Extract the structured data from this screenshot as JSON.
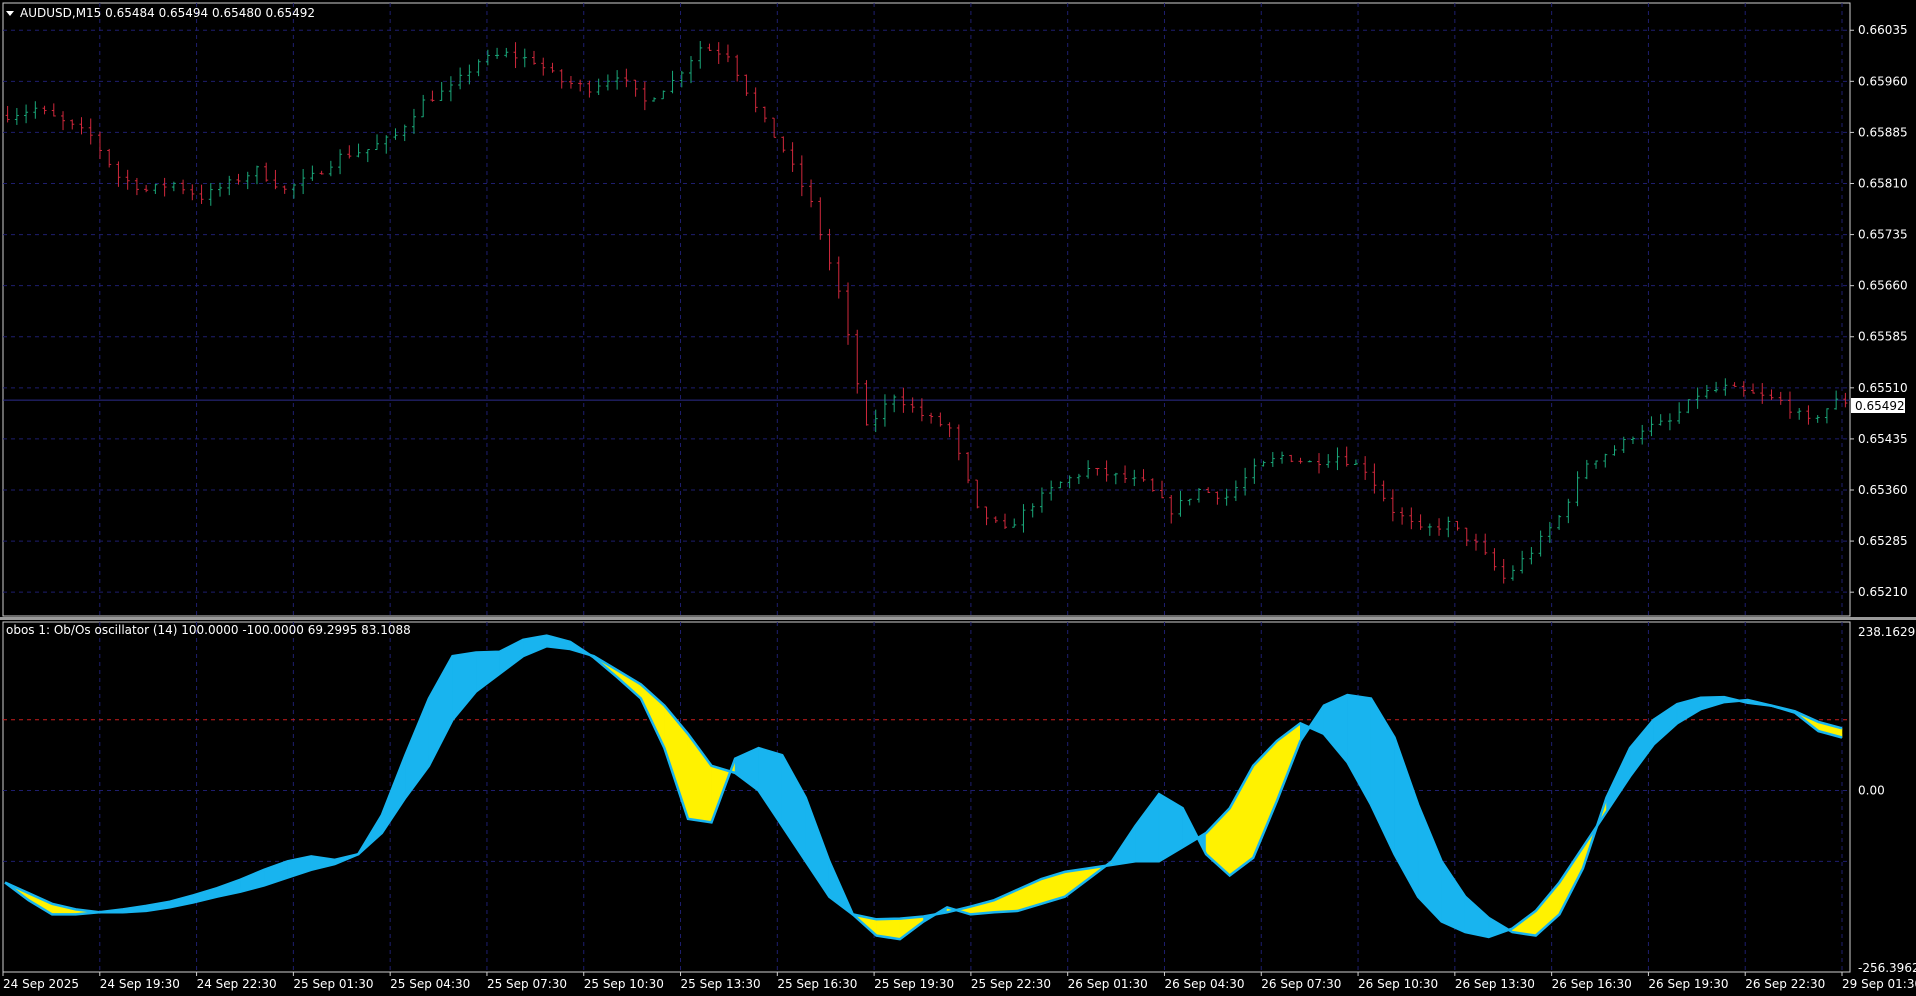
{
  "main_panel": {
    "title": "AUDUSD,M15  0.65484 0.65494 0.65480 0.65492",
    "collapse_icon": "triangle-down-icon",
    "current_price_label": "0.65492"
  },
  "oscillator_panel": {
    "title": "obos 1: Ob/Os oscillator (14) 100.0000 -100.0000 69.2995 83.1088",
    "level_colors": {
      "overbought": "#c81e1e",
      "zero": "#2a2a6e"
    }
  },
  "colors": {
    "background": "#000000",
    "grid": "#1e1e6e",
    "bull": "#1aa87a",
    "bear": "#d0283c",
    "fill_up": "#18b4ef",
    "fill_down": "#fff200",
    "text": "#ffffff",
    "price_line": "#2c2c8c"
  },
  "chart_data": [
    {
      "type": "candlestick",
      "symbol": "AUDUSD",
      "timeframe": "M15",
      "ylim": [
        0.65175,
        0.66075
      ],
      "y_ticks": [
        "0.66035",
        "0.65960",
        "0.65885",
        "0.65810",
        "0.65735",
        "0.65660",
        "0.65585",
        "0.65510",
        "0.65435",
        "0.65360",
        "0.65285",
        "0.65210"
      ],
      "current_price": 0.65492,
      "grid": true,
      "price_path": [
        [
          0,
          0.6591
        ],
        [
          3,
          0.6592
        ],
        [
          6,
          0.659
        ],
        [
          9,
          0.6588
        ],
        [
          12,
          0.6582
        ],
        [
          15,
          0.658
        ],
        [
          18,
          0.6581
        ],
        [
          21,
          0.6579
        ],
        [
          24,
          0.6581
        ],
        [
          27,
          0.6583
        ],
        [
          30,
          0.658
        ],
        [
          33,
          0.6582
        ],
        [
          36,
          0.6585
        ],
        [
          39,
          0.6586
        ],
        [
          42,
          0.6588
        ],
        [
          45,
          0.6593
        ],
        [
          48,
          0.6595
        ],
        [
          51,
          0.6599
        ],
        [
          54,
          0.66
        ],
        [
          57,
          0.6599
        ],
        [
          60,
          0.6596
        ],
        [
          63,
          0.6595
        ],
        [
          66,
          0.6597
        ],
        [
          69,
          0.6593
        ],
        [
          72,
          0.6596
        ],
        [
          75,
          0.6601
        ],
        [
          78,
          0.66
        ],
        [
          81,
          0.6592
        ],
        [
          84,
          0.6586
        ],
        [
          87,
          0.6578
        ],
        [
          90,
          0.6565
        ],
        [
          93,
          0.6545
        ],
        [
          96,
          0.655
        ],
        [
          99,
          0.6547
        ],
        [
          102,
          0.6545
        ],
        [
          105,
          0.6533
        ],
        [
          108,
          0.653
        ],
        [
          111,
          0.6534
        ],
        [
          114,
          0.6537
        ],
        [
          117,
          0.6539
        ],
        [
          120,
          0.6538
        ],
        [
          123,
          0.6537
        ],
        [
          126,
          0.6533
        ],
        [
          129,
          0.6536
        ],
        [
          132,
          0.6535
        ],
        [
          135,
          0.6539
        ],
        [
          138,
          0.6541
        ],
        [
          141,
          0.654
        ],
        [
          144,
          0.6541
        ],
        [
          147,
          0.6539
        ],
        [
          150,
          0.6533
        ],
        [
          153,
          0.653
        ],
        [
          156,
          0.6531
        ],
        [
          159,
          0.6528
        ],
        [
          162,
          0.6523
        ],
        [
          165,
          0.6527
        ],
        [
          168,
          0.6532
        ],
        [
          171,
          0.654
        ],
        [
          174,
          0.6542
        ],
        [
          177,
          0.6545
        ],
        [
          180,
          0.6546
        ],
        [
          183,
          0.655
        ],
        [
          186,
          0.6551
        ],
        [
          189,
          0.655
        ],
        [
          192,
          0.6549
        ],
        [
          195,
          0.6546
        ],
        [
          198,
          0.6549
        ],
        [
          200,
          0.6549
        ]
      ]
    },
    {
      "type": "area",
      "name": "Ob/Os oscillator (14)",
      "ylim": [
        -256.3962,
        238.1629
      ],
      "y_ticks": [
        "238.1629",
        "0.00",
        "-256.3962"
      ],
      "levels": [
        100,
        0,
        -100
      ],
      "x_labels": [
        "24 Sep 2025",
        "24 Sep 19:30",
        "24 Sep 22:30",
        "25 Sep 01:30",
        "25 Sep 04:30",
        "25 Sep 07:30",
        "25 Sep 10:30",
        "25 Sep 13:30",
        "25 Sep 16:30",
        "25 Sep 19:30",
        "25 Sep 22:30",
        "26 Sep 01:30",
        "26 Sep 04:30",
        "26 Sep 07:30",
        "26 Sep 10:30",
        "26 Sep 13:30",
        "26 Sep 16:30",
        "26 Sep 19:30",
        "26 Sep 22:30",
        "29 Sep 01:30"
      ],
      "series": [
        {
          "values": [
            -130,
            -155,
            -175,
            -175,
            -172,
            -168,
            -163,
            -157,
            -148,
            -138,
            -126,
            -112,
            -100,
            -93,
            -98,
            -90,
            -35,
            50,
            130,
            190,
            195,
            196,
            213,
            219,
            210,
            188,
            160,
            130,
            60,
            -40,
            -45,
            45,
            60,
            50,
            -10,
            -100,
            -175,
            -205,
            -210,
            -185,
            -165,
            -175,
            -172,
            -170,
            -160,
            -150,
            -125,
            -100,
            -50,
            -5,
            -25,
            -90,
            -120,
            -95,
            -15,
            70,
            120,
            135,
            130,
            75,
            -20,
            -100,
            -150,
            -180,
            -200,
            -205,
            -175,
            -110,
            -10,
            60,
            100,
            122,
            131,
            132,
            124,
            120,
            110,
            84,
            75
          ]
        },
        {
          "values": [
            -130,
            -145,
            -160,
            -168,
            -172,
            -172,
            -170,
            -165,
            -158,
            -150,
            -143,
            -134,
            -123,
            -112,
            -104,
            -90,
            -60,
            -10,
            35,
            100,
            140,
            165,
            190,
            204,
            200,
            190,
            170,
            150,
            120,
            80,
            35,
            25,
            0,
            -50,
            -100,
            -150,
            -175,
            -182,
            -181,
            -178,
            -172,
            -164,
            -155,
            -140,
            -125,
            -115,
            -110,
            -105,
            -100,
            -100,
            -80,
            -60,
            -25,
            35,
            70,
            95,
            80,
            40,
            -20,
            -90,
            -150,
            -185,
            -200,
            -207,
            -195,
            -170,
            -130,
            -80,
            -30,
            20,
            65,
            95,
            115,
            125,
            128,
            120,
            112,
            97,
            88
          ]
        }
      ]
    }
  ]
}
